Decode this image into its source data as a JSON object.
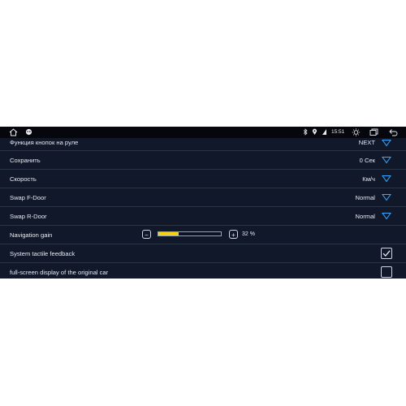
{
  "status_bar": {
    "time": "15:51",
    "icons": [
      "home-icon",
      "android-icon",
      "bluetooth-icon",
      "location-icon",
      "brightness-icon",
      "recent-apps-icon",
      "back-icon"
    ]
  },
  "settings": {
    "rows": [
      {
        "label": "Функция кнопок на руле",
        "value": "NEXT"
      },
      {
        "label": "Сохранить",
        "value": "0 Сек"
      },
      {
        "label": "Скорость",
        "value": "Км/ч"
      },
      {
        "label": "Swap F-Door",
        "value": "Normal"
      },
      {
        "label": "Swap R-Door",
        "value": "Normal"
      }
    ],
    "navigation_gain": {
      "label": "Navigation gain",
      "value": "32 %",
      "fraction": 0.32
    },
    "tactile_feedback": {
      "label": "System tactile feedback",
      "checked": true
    },
    "fullscreen_display": {
      "label": "full-screen display of the original car",
      "checked": false
    }
  },
  "colors": {
    "background": "#10182a",
    "accent_chevron": "#3aa7ff",
    "slider_fill": "#f2d313"
  }
}
